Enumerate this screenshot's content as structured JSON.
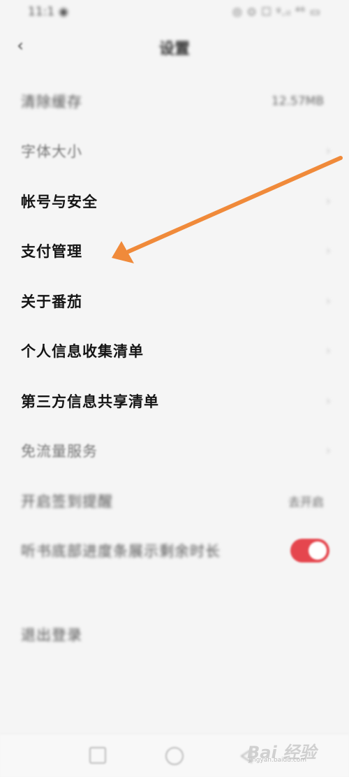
{
  "status_bar": {
    "time": "11:1 ◉",
    "icons": "◎ ⊙ ☐ ᵍ.ᵢₗ ⁴⁶ ▭"
  },
  "header": {
    "back_glyph": "‹",
    "title": "设置"
  },
  "settings": {
    "items": [
      {
        "label": "清除缓存",
        "value": "12.57MB",
        "state": "blurred"
      },
      {
        "label": "字体大小",
        "value": "",
        "state": "faded"
      },
      {
        "label": "帐号与安全",
        "value": "",
        "state": "sharp"
      },
      {
        "label": "支付管理",
        "value": "",
        "state": "sharp"
      },
      {
        "label": "关于番茄",
        "value": "",
        "state": "sharp"
      },
      {
        "label": "个人信息收集清单",
        "value": "",
        "state": "sharp"
      },
      {
        "label": "第三方信息共享清单",
        "value": "",
        "state": "sharp"
      },
      {
        "label": "免流量服务",
        "value": "",
        "state": "faded"
      },
      {
        "label": "开启签到提醒",
        "value": "去开启",
        "state": "blurred"
      },
      {
        "label": "听书底部进度条展示剩余时长",
        "value": "",
        "state": "blurred",
        "toggle_on": true
      }
    ],
    "logout_label": "退出登录"
  },
  "nav_bar": {
    "items": [
      "recent-apps",
      "home",
      "back"
    ]
  },
  "annotation": {
    "arrow_color": "#f08a3a"
  },
  "watermark": {
    "logo": "Bai 经验",
    "sub": "jingyan.baidu.com"
  },
  "colors": {
    "toggle_on": "#e5464e",
    "background": "#f5f5f5"
  }
}
